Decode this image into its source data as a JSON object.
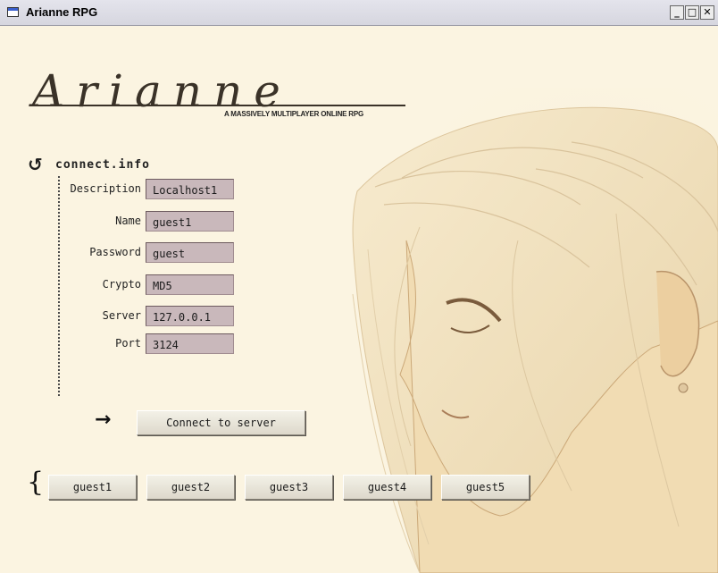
{
  "window": {
    "title": "Arianne RPG",
    "controls": {
      "minimize": "_",
      "maximize": "□",
      "close": "✕"
    }
  },
  "logo": {
    "wordmark": "Arianne",
    "tagline": "A MASSIVELY MULTIPLAYER ONLINE RPG"
  },
  "connect_info": {
    "title": "connect.info",
    "icon": "refresh-icon",
    "fields": [
      {
        "label": "Description",
        "value": "Localhost1"
      },
      {
        "label": "Name",
        "value": "guest1"
      },
      {
        "label": "Password",
        "value": "guest"
      },
      {
        "label": "Crypto",
        "value": "MD5"
      },
      {
        "label": "Server",
        "value": "127.0.0.1"
      },
      {
        "label": "Port",
        "value": "3124"
      }
    ]
  },
  "connect": {
    "arrow": "→",
    "label": "Connect to server"
  },
  "quick": {
    "brace": "{",
    "profiles": [
      "guest1",
      "guest2",
      "guest3",
      "guest4",
      "guest5"
    ]
  },
  "colors": {
    "background": "#fbf4e1",
    "field_fill": "#c9b8bb",
    "text": "#1f1f1f"
  }
}
